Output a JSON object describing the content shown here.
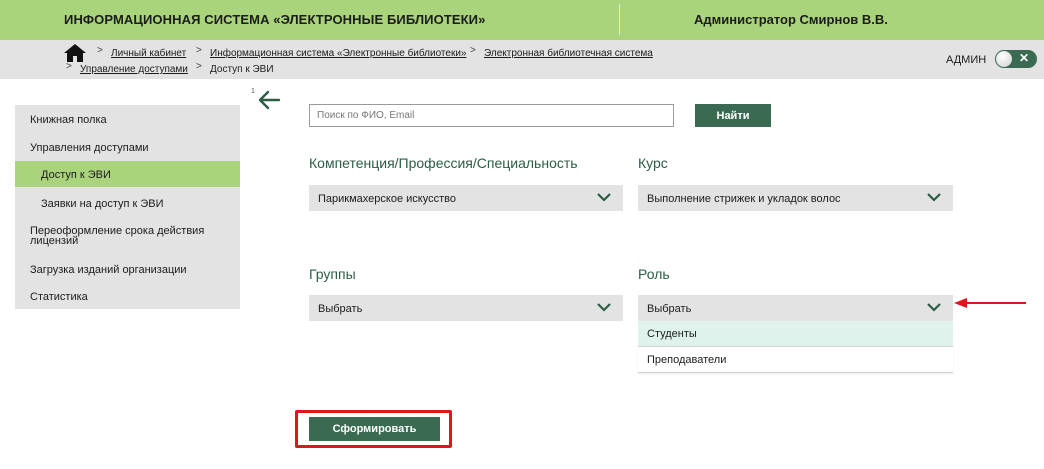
{
  "header": {
    "system_title": "ИНФОРМАЦИОННАЯ СИСТЕМА «ЭЛЕКТРОННЫЕ БИБЛИОТЕКИ»",
    "user_name": "Администратор Смирнов В.В."
  },
  "breadcrumbs": {
    "items": [
      "Личный кабинет",
      "Информационная система «Электронные библиотеки»",
      "Электронная библиотечная система",
      "Управление доступами",
      "Доступ к ЭВИ"
    ],
    "separator": ">",
    "role_label": "АДМИН",
    "toggle_glyph": "✕"
  },
  "sidebar": {
    "items": [
      "Книжная полка",
      "Управления доступами",
      "Доступ к ЭВИ",
      "Заявки на доступ к ЭВИ",
      "Переоформление срока действия лицензий",
      "Загрузка изданий организации",
      "Статистика"
    ],
    "active_item": "Доступ к ЭВИ"
  },
  "back": {
    "mark": "1"
  },
  "search": {
    "placeholder": "Поиск по ФИО, Email",
    "value": "",
    "button_label": "Найти"
  },
  "filters": {
    "competence": {
      "label": "Компетенция/Профессия/Специальность",
      "value": "Парикмахерское искусство"
    },
    "course": {
      "label": "Курс",
      "value": "Выполнение стрижек и укладок волос"
    },
    "groups": {
      "label": "Группы",
      "value": "Выбрать"
    },
    "role": {
      "label": "Роль",
      "value": "Выбрать",
      "options": [
        "Студенты",
        "Преподаватели"
      ],
      "highlighted_option": "Студенты"
    }
  },
  "submit": {
    "label": "Сформировать"
  },
  "colors": {
    "header_green": "#a9d47b",
    "panel_gray": "#e3e3e3",
    "button_dark_green": "#3a6a52",
    "label_green": "#2d5d45",
    "highlight_option": "#dff3ec",
    "annotation_red": "#e0141e"
  },
  "icons": [
    "home-icon",
    "back-arrow-icon",
    "chevron-down-icon",
    "toggle-switch",
    "red-pointer-arrow"
  ]
}
